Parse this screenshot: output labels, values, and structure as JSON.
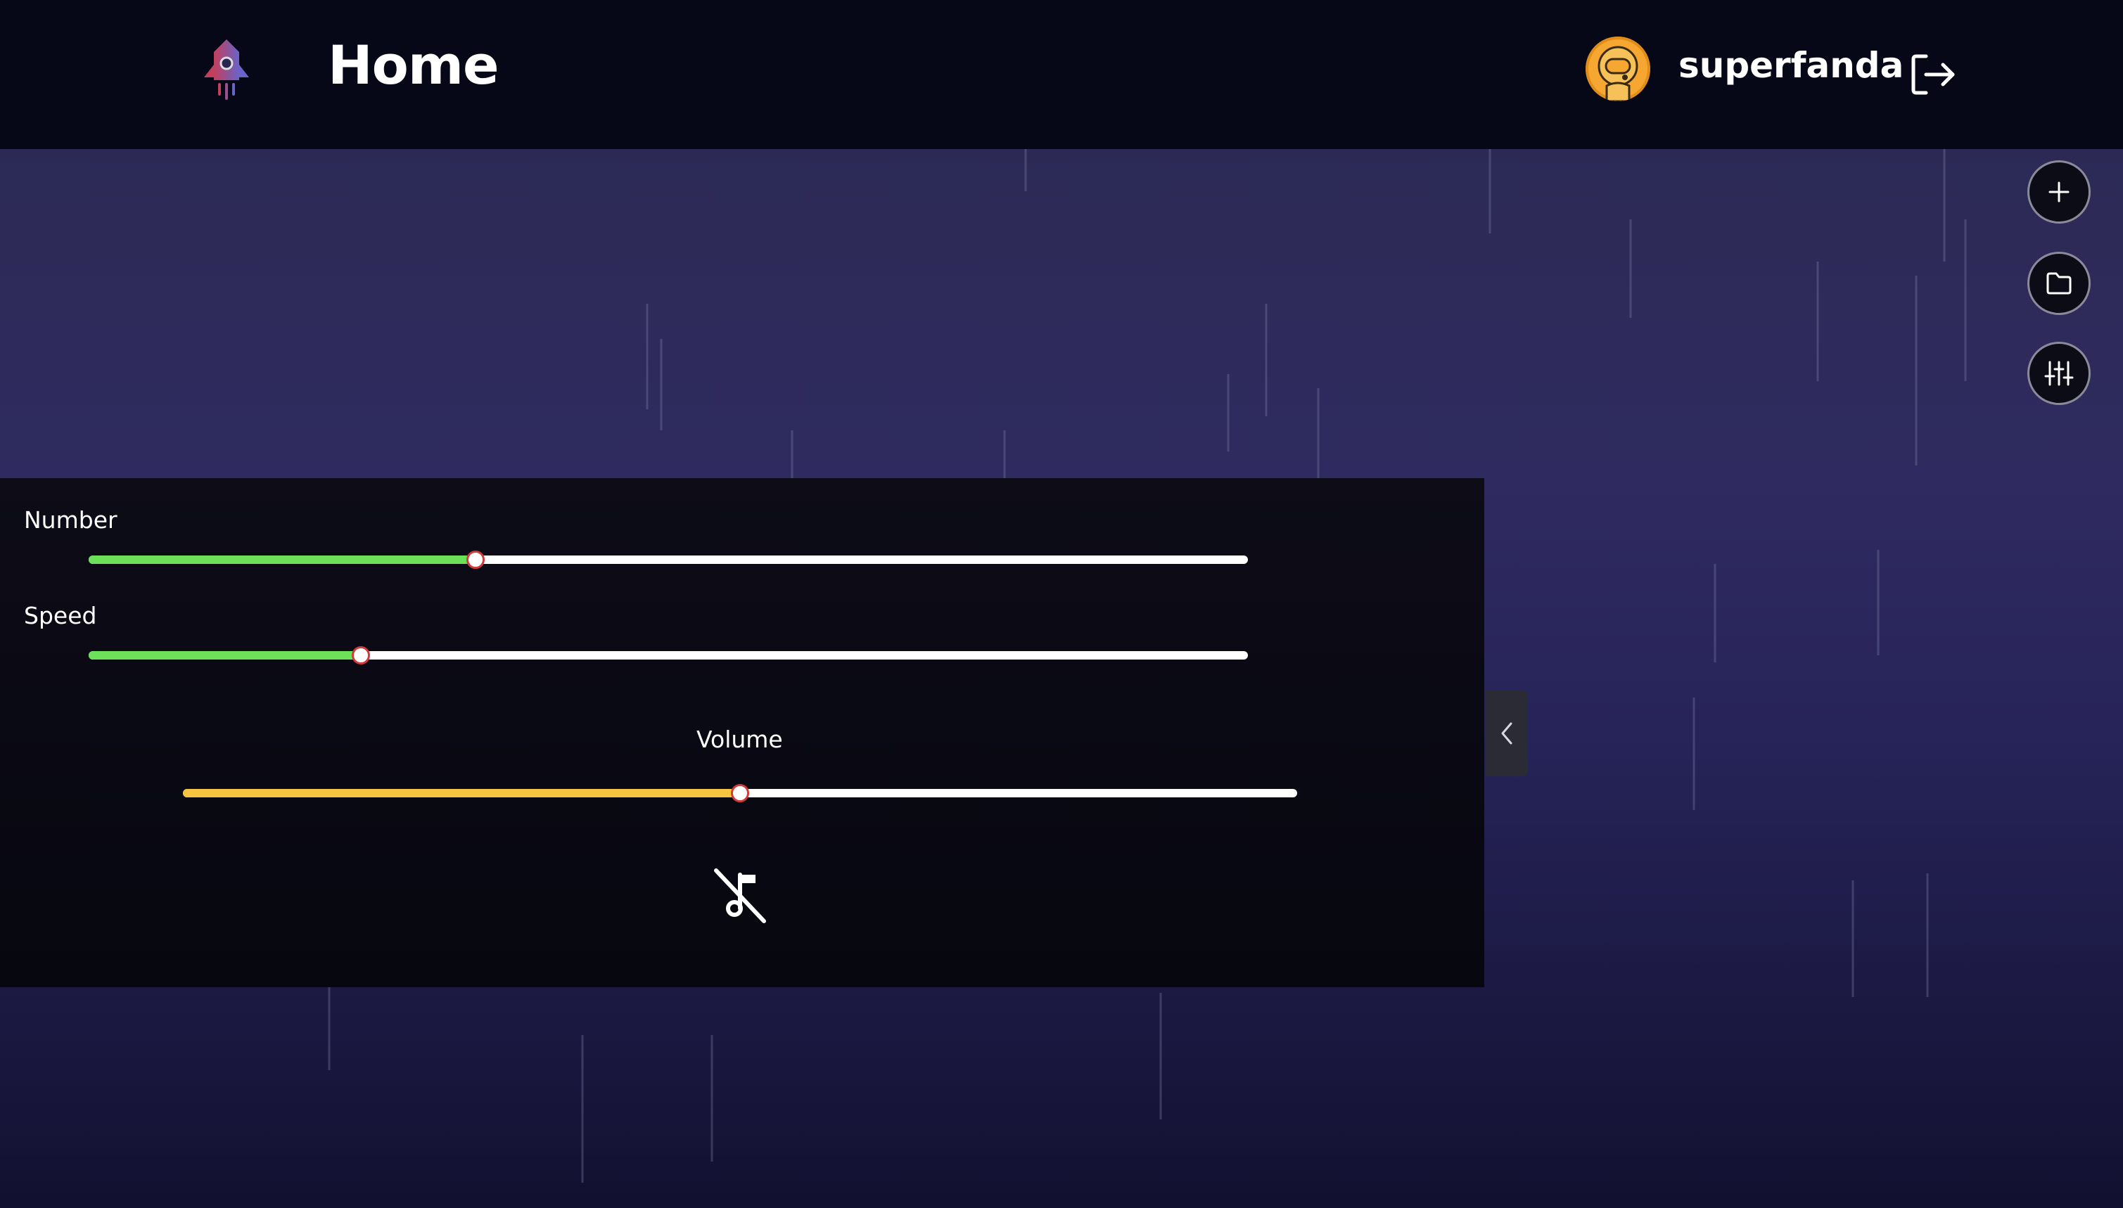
{
  "header": {
    "title": "Home",
    "username": "superfanda",
    "logo_icon": "rocket-icon",
    "avatar_icon": "astronaut-avatar",
    "logout_icon": "logout-icon"
  },
  "actions": [
    {
      "name": "add",
      "icon": "plus-icon"
    },
    {
      "name": "open-folder",
      "icon": "folder-icon"
    },
    {
      "name": "settings",
      "icon": "sliders-icon"
    }
  ],
  "controls": {
    "number": {
      "label": "Number",
      "value": 0.334,
      "color": "#6de05a"
    },
    "speed": {
      "label": "Speed",
      "value": 0.235,
      "color": "#6de05a"
    },
    "volume": {
      "label": "Volume",
      "value": 0.5,
      "color": "#f5c542"
    },
    "mute_icon": "music-off-icon"
  },
  "colors": {
    "header_bg": "#070817",
    "avatar": "#f2a533",
    "thumb_border": "#d03a3a"
  },
  "collapse_icon": "chevron-left-icon"
}
